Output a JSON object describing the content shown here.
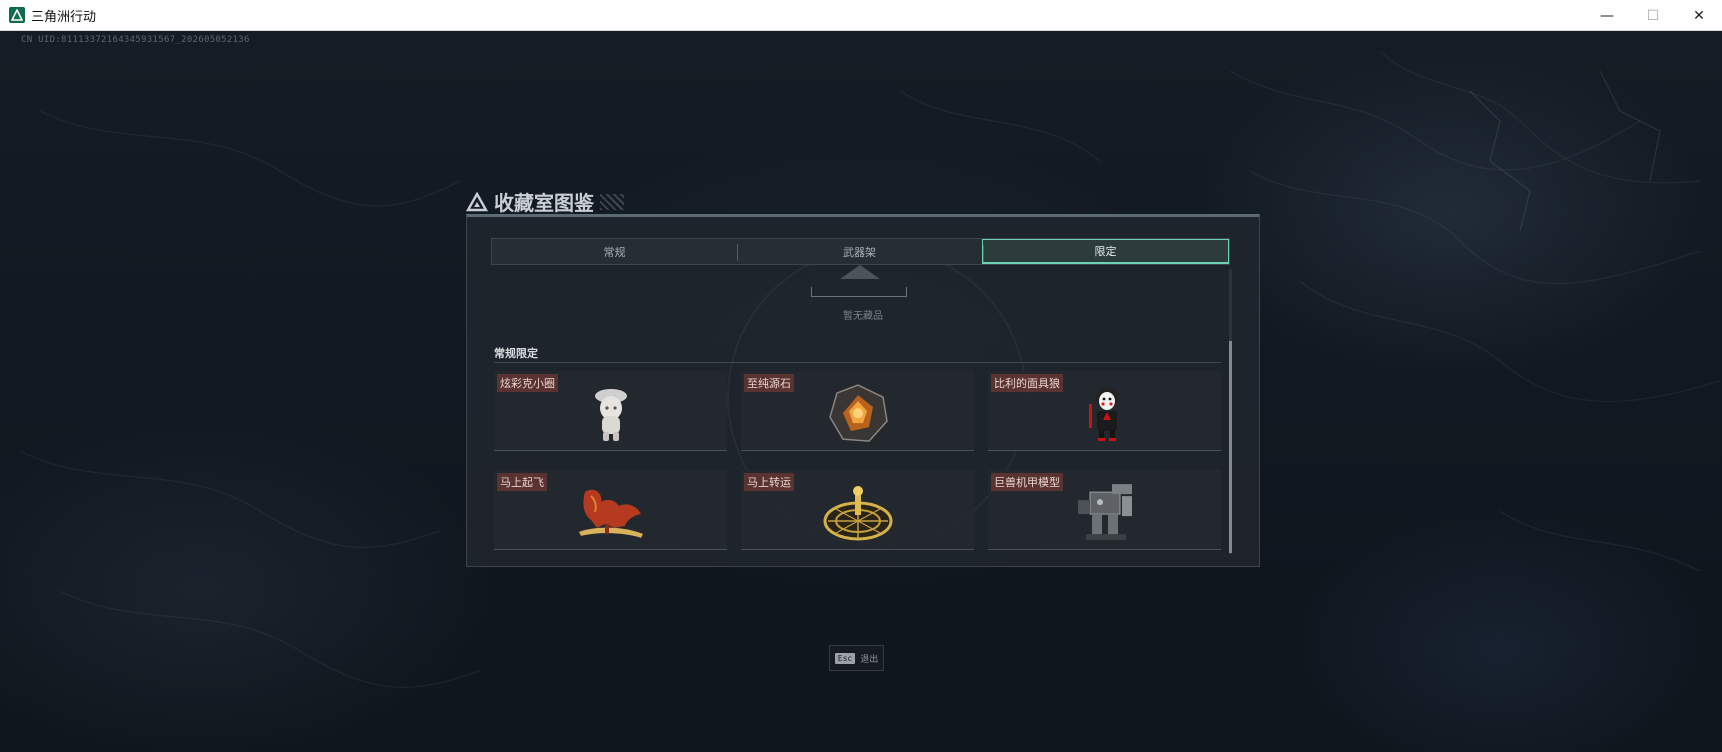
{
  "window": {
    "title": "三角洲行动",
    "controls": {
      "minimize": "—",
      "maximize": "☐",
      "close": "✕"
    }
  },
  "uid": "CN UID:81113372164345931567_202605052136",
  "dialog": {
    "title": "收藏室图鉴",
    "tabs": [
      {
        "label": "常规",
        "active": false
      },
      {
        "label": "武器架",
        "active": false
      },
      {
        "label": "限定",
        "active": true
      }
    ],
    "empty_text": "暂无藏品",
    "section_title": "常规限定",
    "items": [
      {
        "label": "炫彩克小圈",
        "icon": "white-figure-icon"
      },
      {
        "label": "至纯源石",
        "icon": "ore-crystal-icon"
      },
      {
        "label": "比利的面具狼",
        "icon": "puppet-doll-icon"
      },
      {
        "label": "马上起飞",
        "icon": "red-horse-icon"
      },
      {
        "label": "马上转运",
        "icon": "golden-wheel-icon"
      },
      {
        "label": "巨兽机甲模型",
        "icon": "mech-model-icon"
      }
    ]
  },
  "footer": {
    "key": "Esc",
    "text": "退出"
  },
  "colors": {
    "accent": "#6fd2b4",
    "label_bg": "#7a3730",
    "panel_bg": "#20262c"
  }
}
